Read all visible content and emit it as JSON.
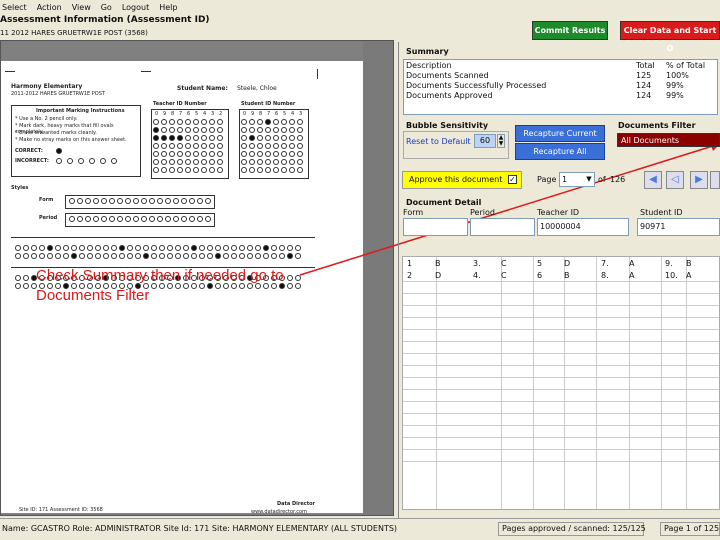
{
  "menu": [
    "Select",
    "Action",
    "View",
    "Go",
    "Logout",
    "Help"
  ],
  "header": {
    "title": "Assessment Information (Assessment ID)",
    "subtitle": "11 2012 HARES GRUETRW1E POST (3568)"
  },
  "sheet": {
    "school": "Harmony Elementary",
    "school_sub": "2011-2012 HARES GRUETRW1E POST",
    "student_name_label": "Student Name:",
    "student_name": "Steele, Chloe",
    "teacher_id_label": "Teacher ID Number",
    "student_id_label": "Student ID Number",
    "instructions_title": "Important Marking Instructions",
    "instructions": [
      "* Use a No. 2 pencil only.",
      "* Mark dark, heavy marks that fill ovals completely.",
      "* Erase unwanted marks cleanly.",
      "* Make no stray marks on this answer sheet."
    ],
    "correct_label": "CORRECT:",
    "incorrect_label": "INCORRECT:",
    "styles_label": "Styles",
    "form_label": "Form",
    "period_label": "Period",
    "footer_left": "Site ID: 171   Assessment ID: 3568",
    "footer_right": "Data Director",
    "footer_right_sub": "www.datadirector.com",
    "digits": [
      "0",
      "9",
      "8",
      "7",
      "6",
      "5",
      "4",
      "3",
      "2",
      "1",
      "0"
    ]
  },
  "callout": "Check Summary then if needed go to Documents Filter",
  "buttons": {
    "commit": "Commit Results",
    "clear": "Clear Data and Start O",
    "recapture_current": "Recapture Current",
    "recapture_all": "Recapture All",
    "approve": "Approve this document"
  },
  "summary": {
    "label": "Summary",
    "headers": [
      "Description",
      "Total",
      "% of Total"
    ],
    "rows": [
      [
        "Documents Scanned",
        "125",
        "100%"
      ],
      [
        "Documents Successfully Processed",
        "124",
        "99%"
      ],
      [
        "Documents Approved",
        "124",
        "99%"
      ]
    ]
  },
  "bubble": {
    "label": "Bubble Sensitivity",
    "reset": "Reset to Default",
    "value": "60"
  },
  "filter": {
    "label": "Documents Filter",
    "value": "All Documents"
  },
  "paging": {
    "page_label": "Page",
    "page_value": "1",
    "of_label": "of",
    "total": "126"
  },
  "detail": {
    "label": "Document Detail",
    "headers": [
      "Form",
      "Period",
      "Teacher ID",
      "Student ID"
    ],
    "teacher_id": "10000004",
    "student_id": "90971",
    "answers": [
      [
        "1",
        "B",
        "3.",
        "C",
        "5",
        "D",
        "7.",
        "A",
        "9.",
        "B"
      ],
      [
        "2",
        "D",
        "4.",
        "C",
        "6",
        "B",
        "8.",
        "A",
        "10.",
        "A"
      ]
    ]
  },
  "status": {
    "user": "Name: GCASTRO  Role: ADMINISTRATOR  Site Id: 171  Site: HARMONY ELEMENTARY (ALL STUDENTS)",
    "pages": "Pages approved / scanned: 125/125",
    "pageof": "Page 1 of 125"
  },
  "colors": {
    "commit": "#1e8b2b",
    "clear": "#d81b1b",
    "approve": "#ffff00",
    "filter": "#8b0000",
    "callout": "#e01818"
  }
}
